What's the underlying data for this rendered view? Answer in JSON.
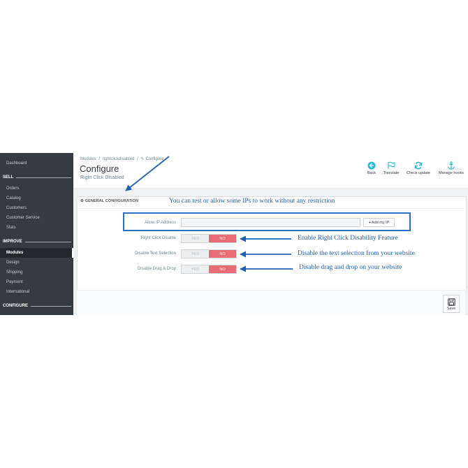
{
  "sidebar": {
    "dashboard": "Dashboard",
    "sell": {
      "title": "SELL",
      "items": [
        "Orders",
        "Catalog",
        "Customers",
        "Customer Service",
        "Stats"
      ]
    },
    "improve": {
      "title": "IMPROVE",
      "items": [
        "Modules",
        "Design",
        "Shipping",
        "Payment",
        "International"
      ],
      "active": "Modules"
    },
    "configure": {
      "title": "CONFIGURE"
    }
  },
  "header": {
    "breadcrumb": [
      "Modules",
      "/",
      "rightclickdisabled",
      "/",
      "Configure"
    ],
    "title": "Configure",
    "subtitle": "Right Click Disabled"
  },
  "toolbar": {
    "back": "Back",
    "translate": "Translate",
    "check_update": "Check update",
    "manage_hooks": "Manage hooks"
  },
  "panel": {
    "heading": "GENERAL CONFIGURATION",
    "allow_ip_label": "Allow IP Address",
    "allow_ip_value": "",
    "add_ip_button": "Add my IP",
    "switches": [
      {
        "label": "Right Click Disable",
        "yes": "YES",
        "no": "NO",
        "value": "NO"
      },
      {
        "label": "Disable Text Selection",
        "yes": "YES",
        "no": "NO",
        "value": "NO"
      },
      {
        "label": "Disable Drag & Drop",
        "yes": "YES",
        "no": "NO",
        "value": "NO"
      }
    ],
    "save": "Save"
  },
  "annotations": {
    "ip_note": "You can test or allow some IPs to work without any restriction",
    "right_click_note": "Enable Right Click Disability Feature",
    "text_selection_note": "Disable the text selection from your website",
    "drag_drop_note": "Disable drag and drop on your website"
  },
  "colors": {
    "sidebar": "#363a41",
    "accent": "#25b9d7",
    "no_active": "#e86d76",
    "annotation": "#1d5fb5"
  }
}
